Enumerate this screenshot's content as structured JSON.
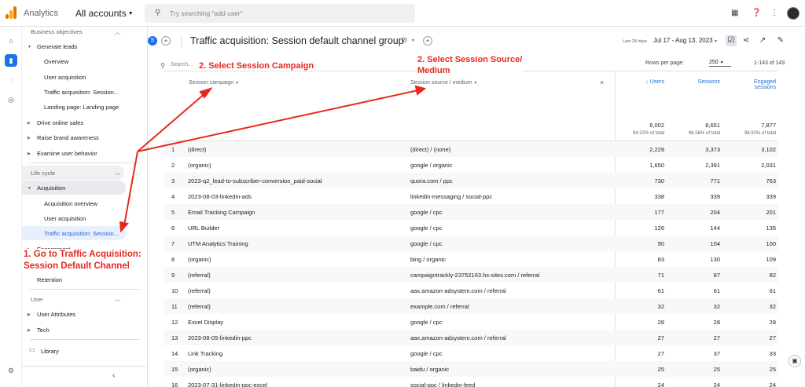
{
  "topbar": {
    "app_name": "Analytics",
    "account": "All accounts",
    "search_placeholder": "Try searching \"add user\""
  },
  "nav": {
    "items": [
      {
        "label": "Business objectives",
        "kind": "section",
        "expanded": true
      },
      {
        "label": "Generate leads",
        "kind": "group",
        "expanded": true
      },
      {
        "label": "Overview",
        "kind": "leaf"
      },
      {
        "label": "User acquisition",
        "kind": "leaf"
      },
      {
        "label": "Traffic acquisition: Session...",
        "kind": "leaf"
      },
      {
        "label": "Landing page: Landing page",
        "kind": "leaf"
      },
      {
        "label": "Drive online sales",
        "kind": "group",
        "expanded": false
      },
      {
        "label": "Raise brand awareness",
        "kind": "group",
        "expanded": false
      },
      {
        "label": "Examine user behavior",
        "kind": "group",
        "expanded": false
      },
      {
        "label": "Life cycle",
        "kind": "section",
        "expanded": true
      },
      {
        "label": "Acquisition",
        "kind": "group",
        "expanded": true
      },
      {
        "label": "Acquisition overview",
        "kind": "leaf"
      },
      {
        "label": "User acquisition",
        "kind": "leaf"
      },
      {
        "label": "Traffic acquisition: Session...",
        "kind": "leaf",
        "selected": true
      },
      {
        "label": "Engagement",
        "kind": "group",
        "expanded": false
      },
      {
        "label": "Retention",
        "kind": "leaf"
      },
      {
        "label": "User",
        "kind": "section",
        "expanded": true
      },
      {
        "label": "User Attributes",
        "kind": "group",
        "expanded": false
      },
      {
        "label": "Tech",
        "kind": "group",
        "expanded": false
      },
      {
        "label": "Library",
        "kind": "library"
      }
    ]
  },
  "header": {
    "property_badge": "S",
    "title": "Traffic acquisition: Session default channel group",
    "date_label": "Last 28 days",
    "date_range": "Jul 17 - Aug 13, 2023"
  },
  "table": {
    "search_placeholder": "Search...",
    "rows_per_page_label": "Rows per page:",
    "rows_per_page": "250",
    "range": "1-143 of 143",
    "dim1_header": "Session campaign",
    "dim2_header": "Session source / medium",
    "metrics": [
      {
        "label": "Users",
        "sorted": true,
        "total": "6,002",
        "pct": "94.22% of total"
      },
      {
        "label": "Sessions",
        "total": "8,651",
        "pct": "96.56% of total"
      },
      {
        "label": "Engaged sessions",
        "label2": "sessions",
        "label1": "Engaged",
        "total": "7,877",
        "pct": "98.92% of total"
      }
    ],
    "rows": [
      {
        "n": "1",
        "campaign": "(direct)",
        "source": "(direct) / (none)",
        "users": "2,229",
        "sessions": "3,373",
        "engaged": "3,102"
      },
      {
        "n": "2",
        "campaign": "(organic)",
        "source": "google / organic",
        "users": "1,650",
        "sessions": "2,391",
        "engaged": "2,031"
      },
      {
        "n": "3",
        "campaign": "2023-q2_lead-to-subscriber-conversion_paid-social",
        "source": "quora.com / ppc",
        "users": "730",
        "sessions": "771",
        "engaged": "763"
      },
      {
        "n": "4",
        "campaign": "2023-08-03-linkedin-ads",
        "source": "linkedin-messaging / social-ppc",
        "users": "338",
        "sessions": "339",
        "engaged": "339"
      },
      {
        "n": "5",
        "campaign": "Email Tracking Campaign",
        "source": "google / cpc",
        "users": "177",
        "sessions": "204",
        "engaged": "201"
      },
      {
        "n": "6",
        "campaign": "URL Builder",
        "source": "google / cpc",
        "users": "126",
        "sessions": "144",
        "engaged": "135"
      },
      {
        "n": "7",
        "campaign": "UTM Analytics Training",
        "source": "google / cpc",
        "users": "90",
        "sessions": "104",
        "engaged": "100"
      },
      {
        "n": "8",
        "campaign": "(organic)",
        "source": "bing / organic",
        "users": "83",
        "sessions": "130",
        "engaged": "109"
      },
      {
        "n": "9",
        "campaign": "(referral)",
        "source": "campaigntrackly-23752163.hs-sites.com / referral",
        "users": "71",
        "sessions": "87",
        "engaged": "82"
      },
      {
        "n": "10",
        "campaign": "(referral)",
        "source": "aax.amazon-adsystem.com / referral",
        "users": "61",
        "sessions": "61",
        "engaged": "61"
      },
      {
        "n": "11",
        "campaign": "(referral)",
        "source": "example.com / referral",
        "users": "32",
        "sessions": "32",
        "engaged": "32"
      },
      {
        "n": "12",
        "campaign": "Excel Display",
        "source": "google / cpc",
        "users": "28",
        "sessions": "28",
        "engaged": "28"
      },
      {
        "n": "13",
        "campaign": "2023-08-05-linkedin-ppc",
        "source": "aax.amazon-adsystem.com / referral",
        "users": "27",
        "sessions": "27",
        "engaged": "27"
      },
      {
        "n": "14",
        "campaign": "Link Tracking",
        "source": "google / cpc",
        "users": "27",
        "sessions": "37",
        "engaged": "33"
      },
      {
        "n": "15",
        "campaign": "(organic)",
        "source": "baidu / organic",
        "users": "25",
        "sessions": "25",
        "engaged": "25"
      },
      {
        "n": "16",
        "campaign": "2023-07-31-linkedin-ppc-excel",
        "source": "social-ppc / linkedin-feed",
        "users": "24",
        "sessions": "24",
        "engaged": "24"
      }
    ]
  },
  "annotations": {
    "step1_line1": "1. Go to Traffic Acquisition:",
    "step1_line2": "Session Default Channel",
    "step2a": "2. Select Session Campaign",
    "step2b_line1": "2. Select Session Source/",
    "step2b_line2": "Medium",
    "color": "#e8281c"
  },
  "colors": {
    "accent": "#1a73e8",
    "selected_bg": "#e8f0fe",
    "hover_bg": "#e8eaed"
  }
}
